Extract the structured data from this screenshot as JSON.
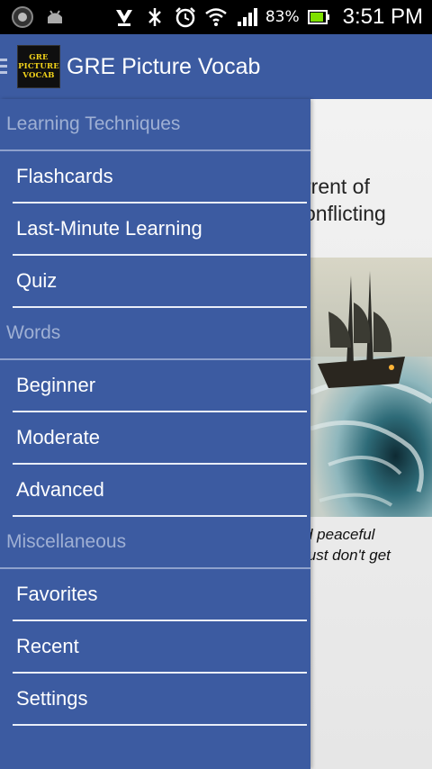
{
  "status_bar": {
    "battery_percent": "83%",
    "time": "3:51 PM",
    "icons": [
      "app-notification-icon",
      "android-debug-icon",
      "download-icon",
      "bluetooth-off-icon",
      "alarm-icon",
      "wifi-icon",
      "signal-icon",
      "battery-icon"
    ]
  },
  "action_bar": {
    "title": "GRE Picture Vocab",
    "logo_lines": [
      "GRE",
      "PICTURE",
      "VOCAB"
    ]
  },
  "drawer": {
    "sections": [
      {
        "header": "Learning Techniques",
        "items": [
          "Flashcards",
          "Last-Minute Learning",
          "Quiz"
        ]
      },
      {
        "header": "Words",
        "items": [
          "Beginner",
          "Moderate",
          "Advanced"
        ]
      },
      {
        "header": "Miscellaneous",
        "items": [
          "Favorites",
          "Recent",
          "Settings"
        ]
      }
    ]
  },
  "content": {
    "definition_lines": [
      "rrent of",
      "onflicting"
    ],
    "caption_lines": [
      "d peaceful",
      "just don't get"
    ]
  },
  "colors": {
    "accent": "#3c5ba1",
    "section_header_text": "#9fb0d4",
    "status_bar": "#000000"
  }
}
